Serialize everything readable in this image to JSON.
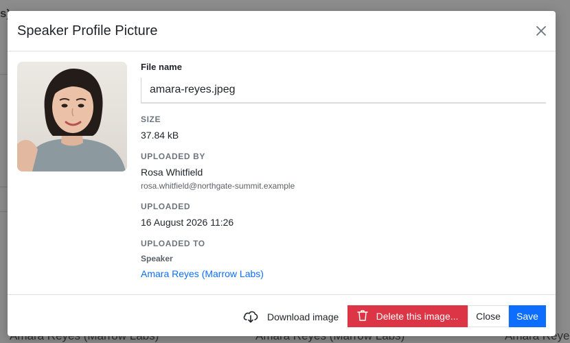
{
  "background": {
    "fragments": [
      "s)",
      "Amara Reyes (Marrow Labs)",
      "Amara Reyes (Marrow Labs)",
      "Amara Reyes"
    ]
  },
  "modal": {
    "title": "Speaker Profile Picture",
    "file_name_label": "File name",
    "file_name_value": "amara-reyes.jpeg",
    "size_label": "SIZE",
    "size_value": "37.84 kB",
    "uploaded_by_label": "UPLOADED BY",
    "uploaded_by_name": "Rosa Whitfield",
    "uploaded_by_email": "rosa.whitfield@northgate-summit.example",
    "uploaded_label": "UPLOADED",
    "uploaded_value": "16 August 2026 11:26",
    "uploaded_to_label": "UPLOADED TO",
    "uploaded_to_type": "Speaker",
    "uploaded_to_link": "Amara Reyes (Marrow Labs)"
  },
  "footer": {
    "download_label": "Download image",
    "delete_label": "Delete this image...",
    "close_label": "Close",
    "save_label": "Save"
  },
  "colors": {
    "danger": "#dc3545",
    "primary": "#0d6efd"
  },
  "icons": {
    "close": "close-icon",
    "download": "cloud-download-icon",
    "delete": "trash-icon"
  }
}
